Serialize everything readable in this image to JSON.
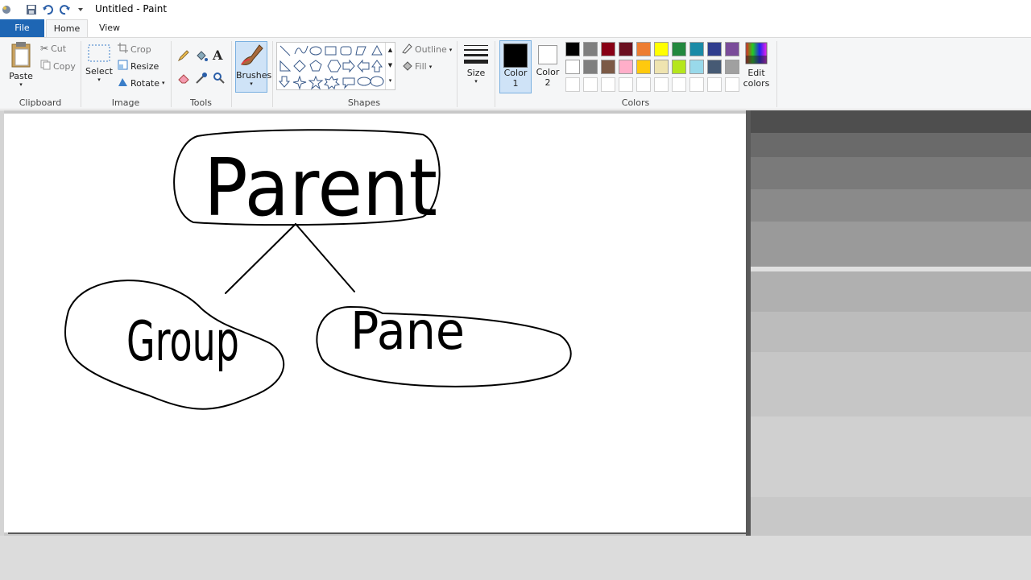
{
  "window": {
    "title": "Untitled - Paint"
  },
  "tabs": {
    "file": "File",
    "home": "Home",
    "view": "View"
  },
  "clipboard": {
    "paste": "Paste",
    "cut": "Cut",
    "copy": "Copy",
    "group": "Clipboard"
  },
  "image": {
    "select": "Select",
    "crop": "Crop",
    "resize": "Resize",
    "rotate": "Rotate",
    "group": "Image"
  },
  "tools": {
    "group": "Tools",
    "text_tool": "A"
  },
  "brushes": {
    "label": "Brushes"
  },
  "shapes": {
    "outline": "Outline",
    "fill": "Fill",
    "group": "Shapes"
  },
  "size": {
    "label": "Size"
  },
  "color1": {
    "label": "Color",
    "number": "1"
  },
  "color2": {
    "label": "Color",
    "number": "2"
  },
  "colors": {
    "group": "Colors",
    "edit_label": "Edit",
    "edit_label2": "colors",
    "row1": [
      "#000000",
      "#7f7f7f",
      "#880015",
      "#6b1020",
      "#ed7d31",
      "#ffff00",
      "#22883e",
      "#1a8aa6",
      "#2f3d8e",
      "#7a4c9a"
    ],
    "row2": [
      "#ffffff",
      "#7f7f7f",
      "#7c5a46",
      "#ffaec9",
      "#ffc90e",
      "#efe4b0",
      "#b5e61d",
      "#99d9ea",
      "#465a74",
      "#a0a0a0"
    ]
  },
  "drawing": {
    "parent_text": "Parent",
    "group_text": "Group",
    "pane_text": "Pane"
  }
}
